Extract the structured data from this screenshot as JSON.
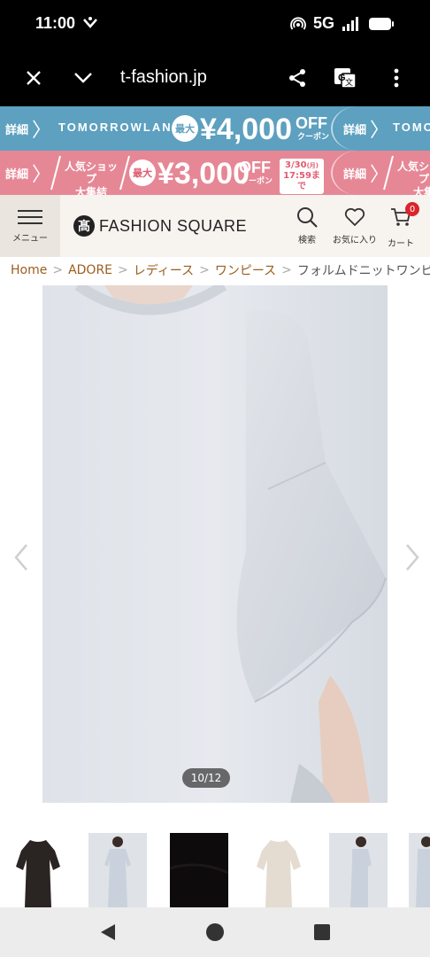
{
  "status_bar": {
    "time": "11:00",
    "network": "5G"
  },
  "browser": {
    "url": "t-fashion.jp"
  },
  "banner1": {
    "detail_label": "詳細",
    "brand": "TOMORROWLAND",
    "max_badge": "最大",
    "amount": "¥4,000",
    "off": "OFF",
    "coupon": "クーポン",
    "detail_label_2": "詳細",
    "brand_partial": "TOMO"
  },
  "banner2": {
    "detail_label": "詳細",
    "shop_line1": "人気ショップ",
    "shop_line2": "大集結",
    "max_badge": "最大",
    "amount": "¥3,000",
    "off": "OFF",
    "coupon": "クーポン",
    "date_line1": "3/30",
    "date_day": "(月)",
    "date_line2": "17:59まで",
    "detail_label_2": "詳細",
    "shop_line1_b": "人気ショップ",
    "shop_line2_b": "大集"
  },
  "header": {
    "menu_label": "メニュー",
    "logo_mark": "髙",
    "logo_text": "FASHION SQUARE",
    "search_label": "検索",
    "favorites_label": "お気に入り",
    "cart_label": "カート",
    "cart_count": "0"
  },
  "breadcrumb": {
    "home": "Home",
    "brand": "ADORE",
    "ladies": "レディース",
    "category": "ワンピース",
    "current": "フォルムドニットワンピース"
  },
  "gallery": {
    "counter": "10/12"
  },
  "colors": {
    "banner1_bg": "#5da0bf",
    "banner2_bg": "#e68796",
    "header_bg": "#f7f3ef",
    "breadcrumb_link": "#9b5d1e",
    "cart_badge": "#d9252a"
  }
}
